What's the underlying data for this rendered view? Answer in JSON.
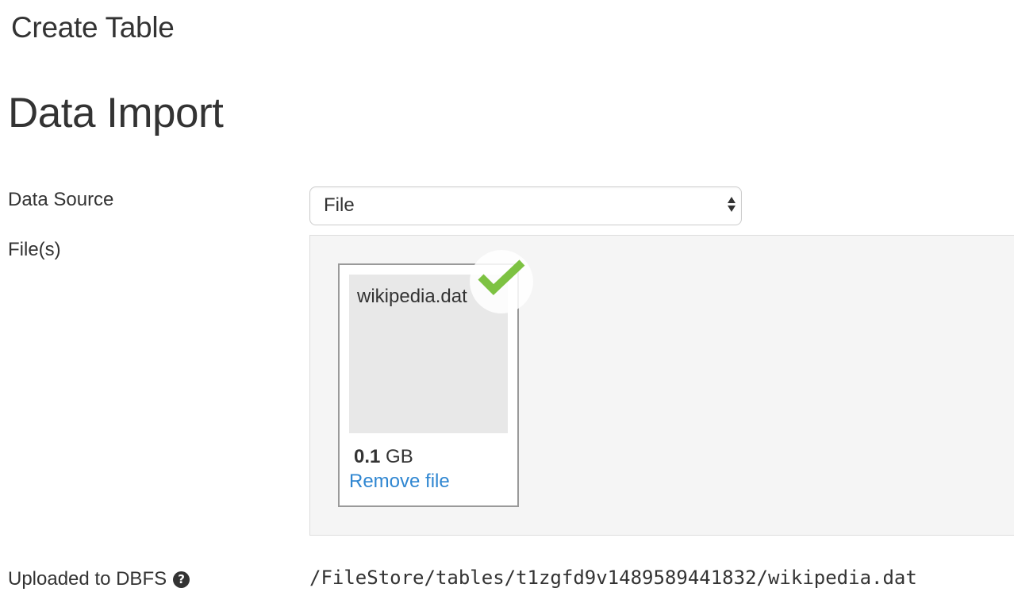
{
  "header": {
    "title": "Create Table"
  },
  "section": {
    "title": "Data Import"
  },
  "form": {
    "data_source": {
      "label": "Data Source",
      "selected": "File"
    },
    "files": {
      "label": "File(s)",
      "items": [
        {
          "name": "wikipedia.dat",
          "size_value": "0.1",
          "size_unit": "GB",
          "remove_label": "Remove file",
          "status_icon": "check-icon"
        }
      ]
    },
    "dbfs": {
      "label": "Uploaded to DBFS",
      "help_icon": "question-circle-icon",
      "help_glyph": "?",
      "path": "/FileStore/tables/t1zgfd9v1489589441832/wikipedia.dat"
    }
  },
  "colors": {
    "link": "#2f86d1",
    "success": "#7dc242",
    "text": "#333333",
    "dropzone_bg": "#f5f5f5"
  }
}
